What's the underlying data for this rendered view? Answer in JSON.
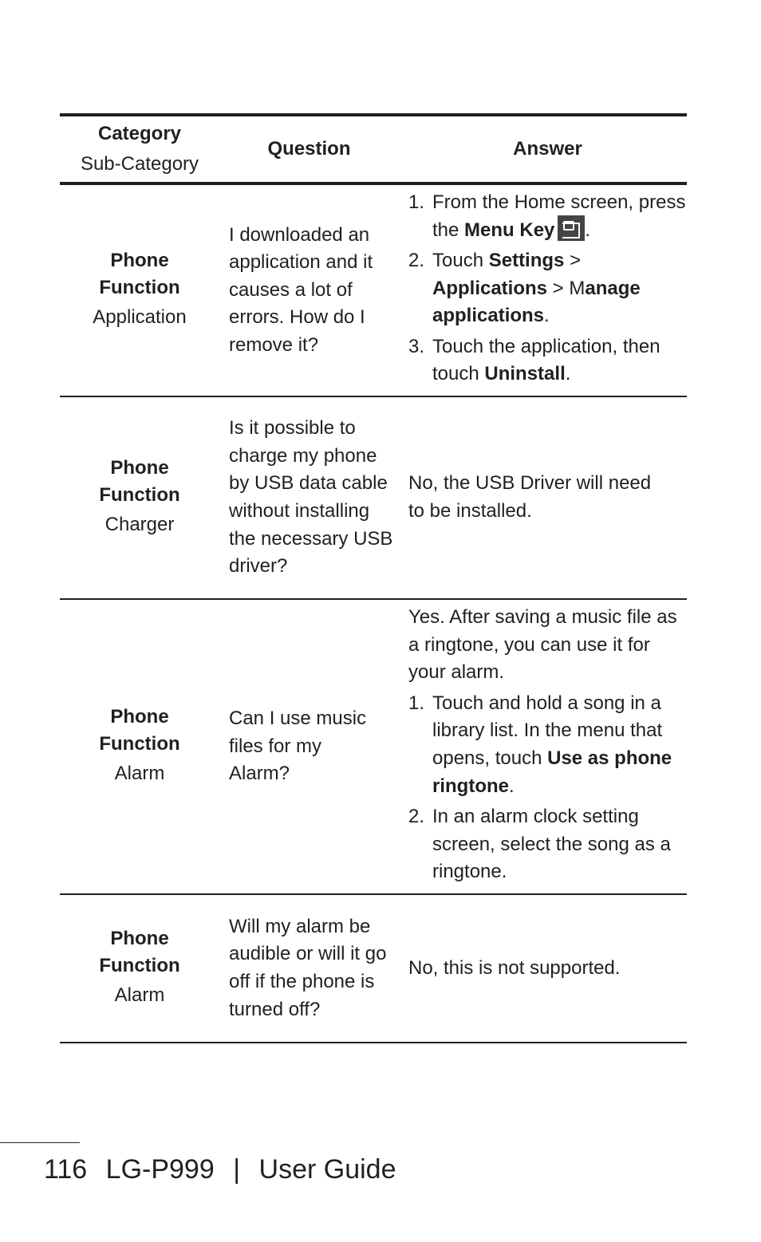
{
  "header": {
    "category": "Category",
    "sub_category": "Sub-Category",
    "question": "Question",
    "answer": "Answer"
  },
  "rows": [
    {
      "category": "Phone Function",
      "sub_category": "Application",
      "question": "I downloaded an application and it causes a lot of errors. How do I remove it?",
      "steps": [
        {
          "n": "1.",
          "parts": [
            "From the Home screen, press the ",
            "Menu Key",
            "."
          ]
        },
        {
          "n": "2.",
          "parts": [
            "Touch ",
            "Settings",
            " > ",
            "Applications",
            " > M",
            "anage applications",
            "."
          ]
        },
        {
          "n": "3.",
          "parts": [
            "Touch the application, then touch ",
            "Uninstall",
            "."
          ]
        }
      ]
    },
    {
      "category": "Phone Function",
      "sub_category": "Charger",
      "question": "Is it possible to charge my phone by USB data cable without installing the necessary USB driver?",
      "answer": "No, the USB Driver will need to be installed."
    },
    {
      "category": "Phone Function",
      "sub_category": "Alarm",
      "question": "Can I use music files for my Alarm?",
      "intro": "Yes. After saving a music file as a ringtone, you can use it for your alarm.",
      "steps": [
        {
          "n": "1.",
          "parts": [
            "Touch and hold a song in a library list. In the menu that opens, touch ",
            "Use as phone ringtone",
            "."
          ]
        },
        {
          "n": "2.",
          "parts": [
            "In an alarm clock setting screen, select the song as a ringtone."
          ]
        }
      ]
    },
    {
      "category": "Phone Function",
      "sub_category": "Alarm",
      "question": "Will my alarm be audible or will it go off if the phone is turned off?",
      "answer": "No, this is not supported."
    }
  ],
  "footer": {
    "page": "116",
    "model": "LG-P999",
    "sep": "|",
    "title": "User Guide"
  }
}
